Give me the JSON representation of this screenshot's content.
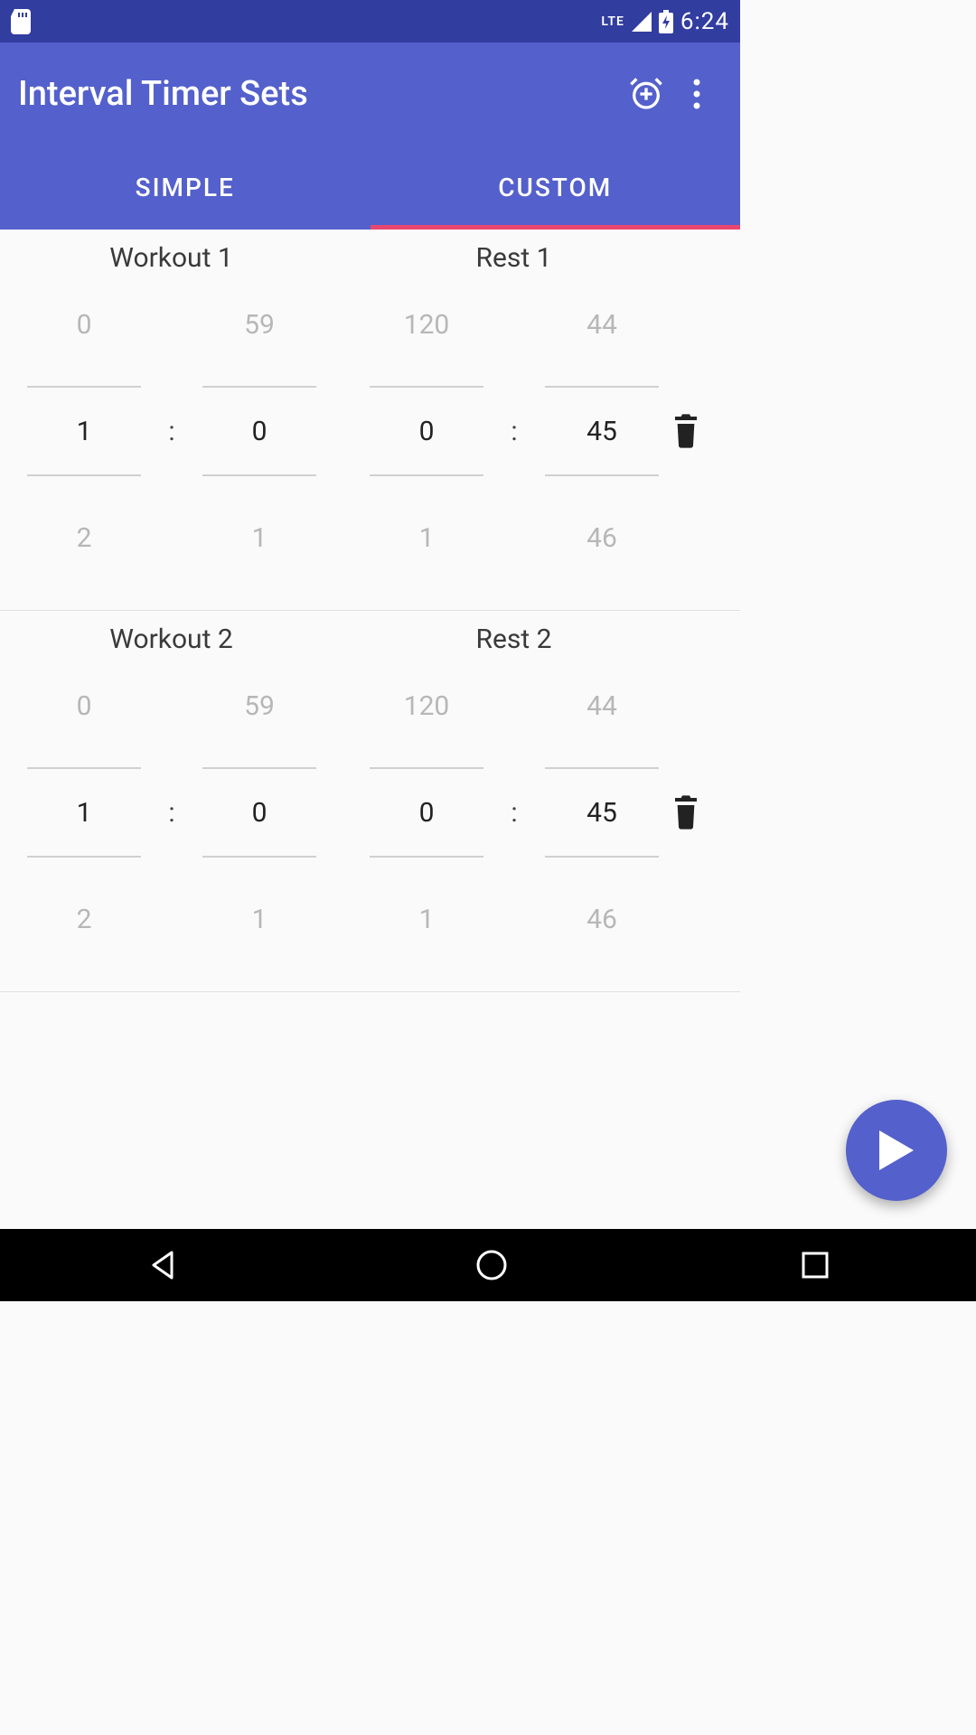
{
  "status": {
    "time": "6:24",
    "lte": "LTE"
  },
  "header": {
    "title": "Interval Timer Sets"
  },
  "tabs": {
    "simple": "SIMPLE",
    "custom": "CUSTOM"
  },
  "sets": [
    {
      "workout_label": "Workout 1",
      "rest_label": "Rest 1",
      "workout": {
        "min": {
          "above": "0",
          "value": "1",
          "below": "2"
        },
        "sec": {
          "above": "59",
          "value": "0",
          "below": "1"
        }
      },
      "rest": {
        "min": {
          "above": "120",
          "value": "0",
          "below": "1"
        },
        "sec": {
          "above": "44",
          "value": "45",
          "below": "46"
        }
      }
    },
    {
      "workout_label": "Workout 2",
      "rest_label": "Rest 2",
      "workout": {
        "min": {
          "above": "0",
          "value": "1",
          "below": "2"
        },
        "sec": {
          "above": "59",
          "value": "0",
          "below": "1"
        }
      },
      "rest": {
        "min": {
          "above": "120",
          "value": "0",
          "below": "1"
        },
        "sec": {
          "above": "44",
          "value": "45",
          "below": "46"
        }
      }
    }
  ]
}
